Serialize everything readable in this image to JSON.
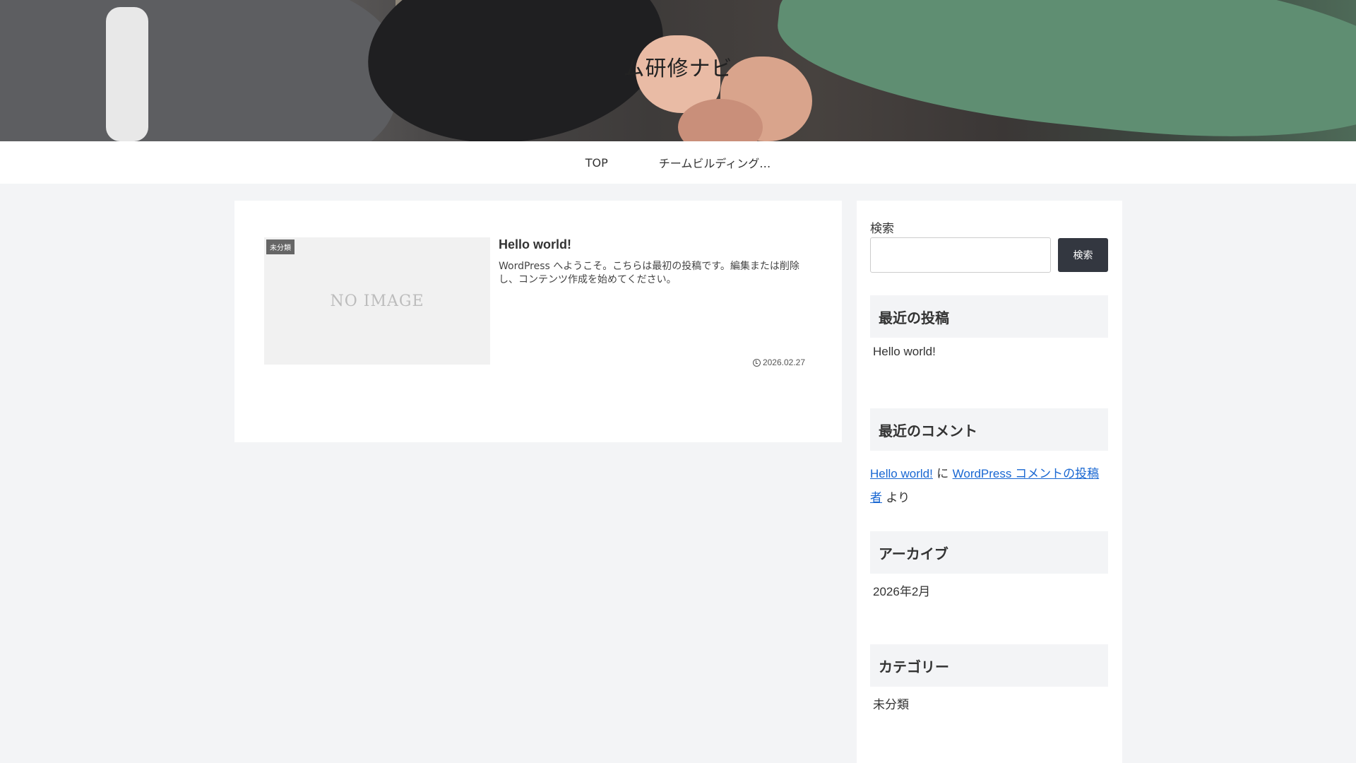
{
  "site": {
    "title": "ム研修ナビ"
  },
  "nav": {
    "items": [
      {
        "label": "TOP"
      },
      {
        "label": "チームビルディング…"
      }
    ]
  },
  "post": {
    "category": "未分類",
    "thumbnail_text": "NO IMAGE",
    "title": "Hello world!",
    "snippet": "WordPress へようこそ。こちらは最初の投稿です。編集または削除し、コンテンツ作成を始めてください。",
    "date": "2026.02.27"
  },
  "sidebar": {
    "search": {
      "label": "検索",
      "button": "検索",
      "value": ""
    },
    "recent_posts": {
      "heading": "最近の投稿",
      "items": [
        "Hello world!"
      ]
    },
    "recent_comments": {
      "heading": "最近のコメント",
      "post_link": "Hello world!",
      "connector": " に ",
      "author_link": "WordPress コメントの投稿者",
      "suffix": " より"
    },
    "archives": {
      "heading": "アーカイブ",
      "items": [
        "2026年2月"
      ]
    },
    "categories": {
      "heading": "カテゴリー",
      "items": [
        "未分類"
      ]
    }
  }
}
